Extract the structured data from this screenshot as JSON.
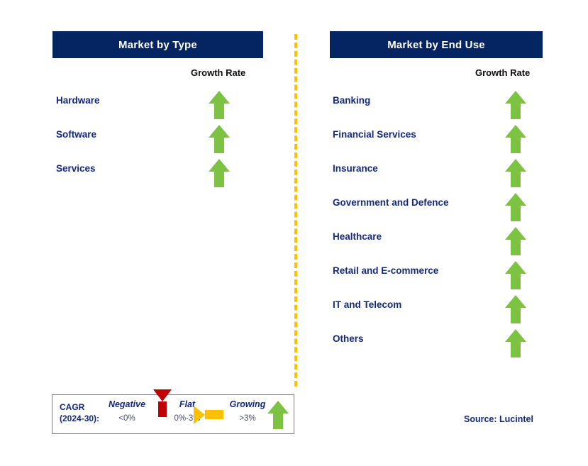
{
  "panels": [
    {
      "id": "market-by-type",
      "title": "Market by Type",
      "growth_rate_header": "Growth Rate",
      "rows": [
        {
          "label": "Hardware",
          "trend": "growing",
          "trend_icon": "arrow-up-icon"
        },
        {
          "label": "Software",
          "trend": "growing",
          "trend_icon": "arrow-up-icon"
        },
        {
          "label": "Services",
          "trend": "growing",
          "trend_icon": "arrow-up-icon"
        }
      ]
    },
    {
      "id": "market-by-end-use",
      "title": "Market by End Use",
      "growth_rate_header": "Growth Rate",
      "rows": [
        {
          "label": "Banking",
          "trend": "growing",
          "trend_icon": "arrow-up-icon"
        },
        {
          "label": "Financial Services",
          "trend": "growing",
          "trend_icon": "arrow-up-icon"
        },
        {
          "label": "Insurance",
          "trend": "growing",
          "trend_icon": "arrow-up-icon"
        },
        {
          "label": "Government and Defence",
          "trend": "growing",
          "trend_icon": "arrow-up-icon"
        },
        {
          "label": "Healthcare",
          "trend": "growing",
          "trend_icon": "arrow-up-icon"
        },
        {
          "label": "Retail and E-commerce",
          "trend": "growing",
          "trend_icon": "arrow-up-icon"
        },
        {
          "label": "IT and Telecom",
          "trend": "growing",
          "trend_icon": "arrow-up-icon"
        },
        {
          "label": "Others",
          "trend": "growing",
          "trend_icon": "arrow-up-icon"
        }
      ]
    }
  ],
  "legend": {
    "title_line1": "CAGR",
    "title_line2": "(2024-30):",
    "entries": [
      {
        "name": "Negative",
        "range": "<0%",
        "icon": "arrow-down-icon",
        "color": "#C00000"
      },
      {
        "name": "Flat",
        "range": "0%-3%",
        "icon": "arrow-right-icon",
        "color": "#FFC000"
      },
      {
        "name": "Growing",
        "range": ">3%",
        "icon": "arrow-up-icon",
        "color": "#7DC242"
      }
    ]
  },
  "source": "Source: Lucintel",
  "colors": {
    "header_bar": "#052462",
    "label_text": "#13287e",
    "growing": "#7DC242",
    "negative": "#C00000",
    "flat": "#FFC000",
    "divider": "#FFC000"
  }
}
